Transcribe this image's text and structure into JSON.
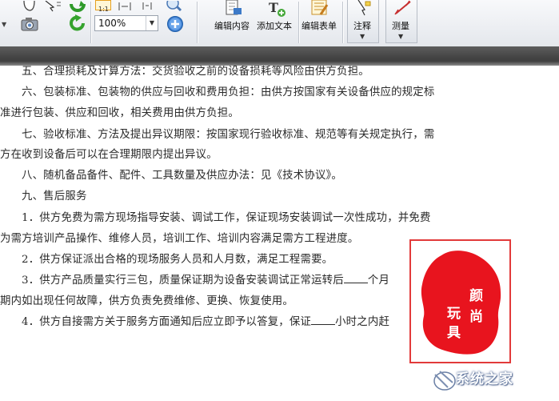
{
  "toolbar": {
    "zoom_value": "100%",
    "edit_content_label": "编辑内容",
    "add_text_label": "添加文本",
    "edit_form_label": "编辑表单",
    "annotate_label": "注释",
    "measure_label": "测量"
  },
  "document": {
    "lines": [
      "五、合理损耗及计算方法：交货验收之前的设备损耗等风险由供方负担。",
      "六、包装标准、包装物的供应与回收和费用负担：由供方按国家有关设备供应的规定标",
      "准进行包装、供应和回收，相关费用由供方负担。",
      "七、验收标准、方法及提出异议期限：按国家现行验收标准、规范等有关规定执行，需",
      "方在收到设备后可以在合理期限内提出异议。",
      "八、随机备品备件、配件、工具数量及供应办法：见《技术协议》。",
      "九、售后服务",
      "1．供方免费为需方现场指导安装、调试工作，保证现场安装调试一次性成功，并免费",
      "为需方培训产品操作、维修人员，培训工作、培训内容满足需方工程进度。",
      "2．供方保证派出合格的现场服务人员和人月数，满足工程需要。",
      "3．供方产品质量实行三包，质量保证期为设备安装调试正常运转后",
      "个月",
      "期内如出现任何故障，供方负责免费维修、更换、恢复使用。",
      "4．供方自接需方关于服务方面通知后应立即予以答复，保证",
      "小时之内赶"
    ]
  },
  "seal": {
    "chars": [
      "玩",
      "具",
      "颜",
      "尚"
    ],
    "color": "#e8141e"
  },
  "watermark": {
    "text": "系统之家"
  }
}
